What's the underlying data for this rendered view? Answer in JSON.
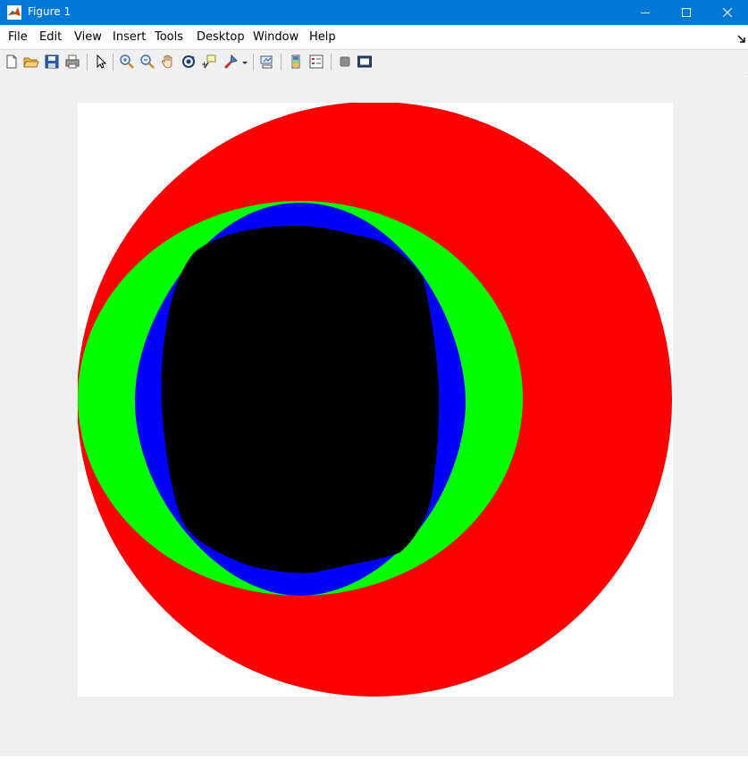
{
  "window": {
    "title": "Figure 1",
    "accent_color": "#0078d7",
    "controls": [
      "minimize-icon",
      "maximize-icon",
      "close-icon"
    ]
  },
  "menu": {
    "items": [
      "File",
      "Edit",
      "View",
      "Insert",
      "Tools",
      "Desktop",
      "Window",
      "Help"
    ],
    "overflow_icon": "dock-arrow-icon"
  },
  "toolbar": {
    "icons": [
      "new-figure-icon",
      "open-file-icon",
      "save-icon",
      "print-icon",
      "edit-plot-icon",
      "zoom-in-icon",
      "zoom-out-icon",
      "pan-icon",
      "rotate-3d-icon",
      "data-cursor-icon",
      "brush-icon",
      "brush-dropdown-icon",
      "link-plot-icon",
      "colorbar-icon",
      "legend-icon",
      "hide-plot-tools-icon",
      "show-plot-tools-icon"
    ]
  },
  "figure": {
    "shapes": [
      {
        "name": "outer-disk",
        "color": "#ff0000"
      },
      {
        "name": "middle-ellipse",
        "color": "#00ff00"
      },
      {
        "name": "inner-oval",
        "color": "#0000ff"
      },
      {
        "name": "core-blob",
        "color": "#000000"
      }
    ],
    "axes_background": "#ffffff"
  }
}
